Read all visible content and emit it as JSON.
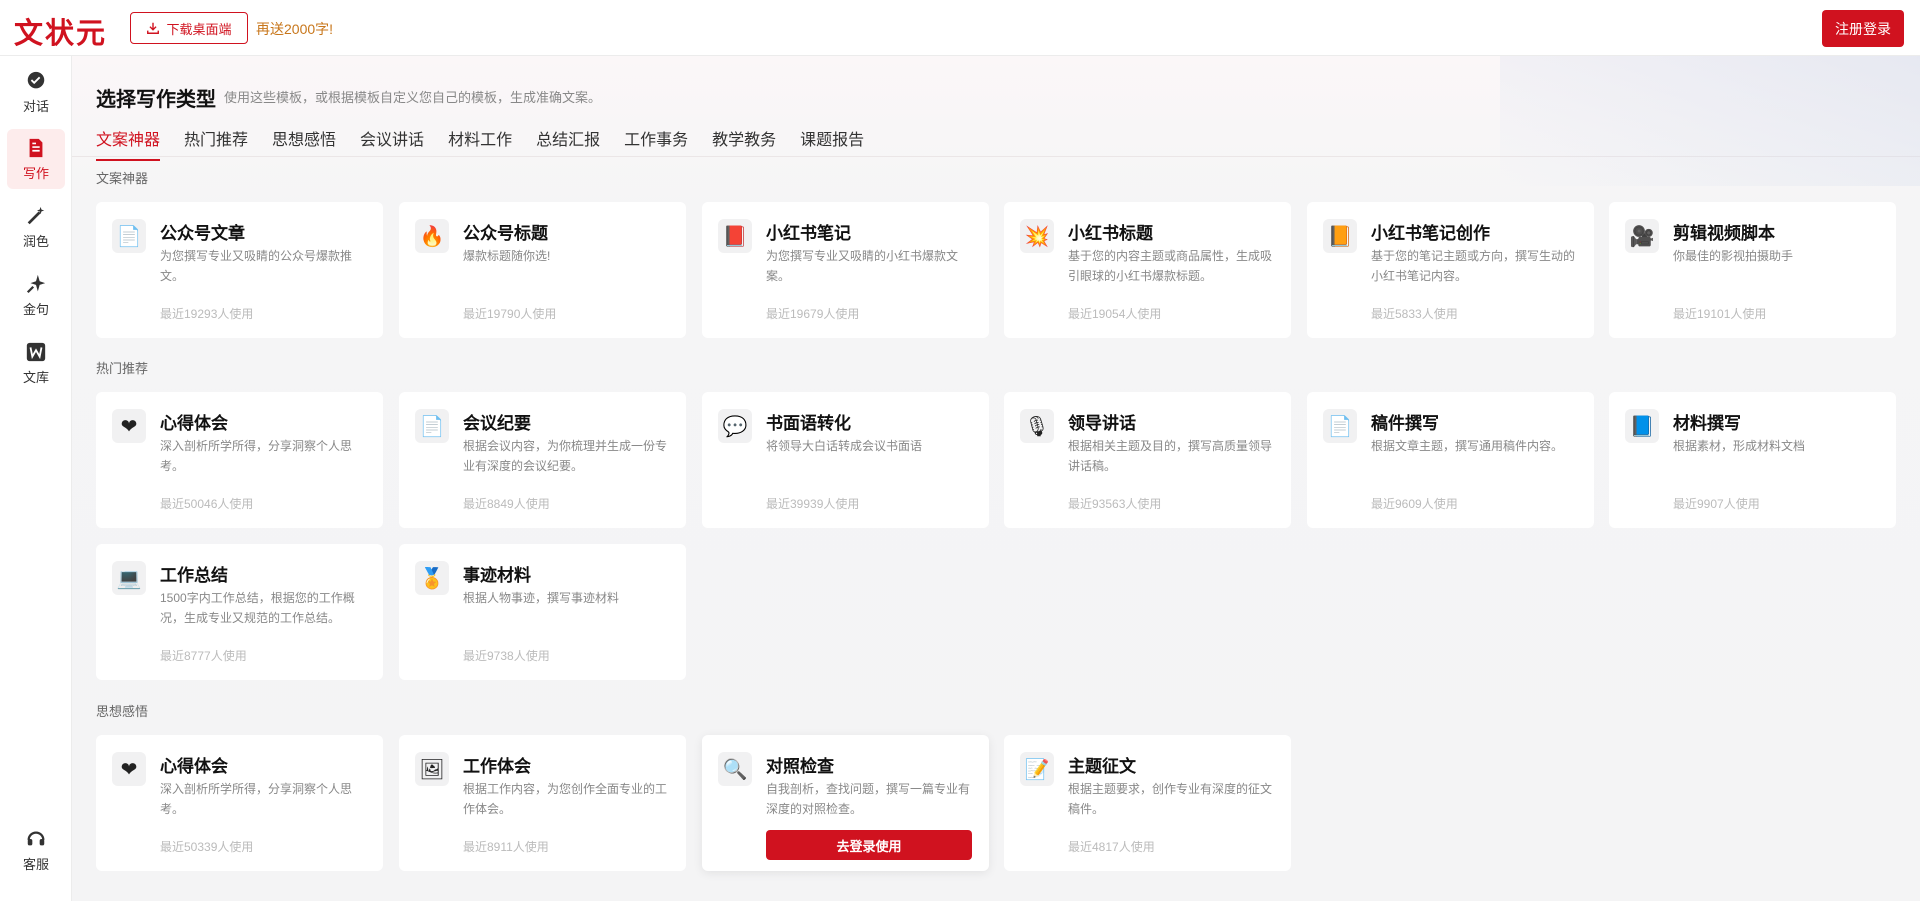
{
  "header": {
    "logo": "文状元",
    "download_label": "下载桌面端",
    "promo": "再送2000字!",
    "login_label": "注册登录"
  },
  "sidenav": [
    {
      "label": "对话",
      "icon": "chat-bubble-icon"
    },
    {
      "label": "写作",
      "icon": "document-icon",
      "active": true
    },
    {
      "label": "润色",
      "icon": "magic-wand-icon"
    },
    {
      "label": "金句",
      "icon": "sparkle-icon"
    },
    {
      "label": "文库",
      "icon": "w-library-icon"
    },
    {
      "label": "客服",
      "icon": "headset-icon"
    }
  ],
  "page": {
    "title": "选择写作类型",
    "subtitle": "使用这些模板，或根据模板自定义您自己的模板，生成准确文案。"
  },
  "tabs": [
    "文案神器",
    "热门推荐",
    "思想感悟",
    "会议讲话",
    "材料工作",
    "总结汇报",
    "工作事务",
    "教学教务",
    "课题报告"
  ],
  "active_tab": "文案神器",
  "sections": [
    {
      "label": "文案神器",
      "cards": [
        {
          "icon": "📄",
          "icon_name": "page-icon",
          "title": "公众号文章",
          "desc": "为您撰写专业又吸睛的公众号爆款推文。",
          "usage": "最近19293人使用"
        },
        {
          "icon": "🔥",
          "icon_name": "fire-icon",
          "title": "公众号标题",
          "desc": "爆款标题随你选!",
          "usage": "最近19790人使用"
        },
        {
          "icon": "📕",
          "icon_name": "red-book-icon",
          "title": "小红书笔记",
          "desc": "为您撰写专业又吸睛的小红书爆款文案。",
          "usage": "最近19679人使用"
        },
        {
          "icon": "💥",
          "icon_name": "explosion-icon",
          "title": "小红书标题",
          "desc": "基于您的内容主题或商品属性，生成吸引眼球的小红书爆款标题。",
          "usage": "最近19054人使用"
        },
        {
          "icon": "📙",
          "icon_name": "notebook-icon",
          "title": "小红书笔记创作",
          "desc": "基于您的笔记主题或方向，撰写生动的小红书笔记内容。",
          "usage": "最近5833人使用"
        },
        {
          "icon": "🎥",
          "icon_name": "video-camera-icon",
          "title": "剪辑视频脚本",
          "desc": "你最佳的影视拍摄助手",
          "usage": "最近19101人使用"
        }
      ]
    },
    {
      "label": "热门推荐",
      "cards": [
        {
          "icon": "❤",
          "icon_name": "heart-icon",
          "title": "心得体会",
          "desc": "深入剖析所学所得，分享洞察个人思考。",
          "usage": "最近50046人使用"
        },
        {
          "icon": "📄",
          "icon_name": "page-icon",
          "title": "会议纪要",
          "desc": "根据会议内容，为你梳理并生成一份专业有深度的会议纪要。",
          "usage": "最近8849人使用"
        },
        {
          "icon": "💬",
          "icon_name": "speech-bubble-icon",
          "title": "书面语转化",
          "desc": "将领导大白话转成会议书面语",
          "usage": "最近39939人使用"
        },
        {
          "icon": "🎙",
          "icon_name": "microphone-icon",
          "title": "领导讲话",
          "desc": "根据相关主题及目的，撰写高质量领导讲话稿。",
          "usage": "最近93563人使用"
        },
        {
          "icon": "📄",
          "icon_name": "page-icon",
          "title": "稿件撰写",
          "desc": "根据文章主题，撰写通用稿件内容。",
          "usage": "最近9609人使用"
        },
        {
          "icon": "📘",
          "icon_name": "blue-book-icon",
          "title": "材料撰写",
          "desc": "根据素材，形成材料文档",
          "usage": "最近9907人使用"
        },
        {
          "icon": "💻",
          "icon_name": "laptop-icon",
          "title": "工作总结",
          "desc": "1500字内工作总结，根据您的工作概况，生成专业又规范的工作总结。",
          "usage": "最近8777人使用"
        },
        {
          "icon": "🏅",
          "icon_name": "medal-icon",
          "title": "事迹材料",
          "desc": "根据人物事迹，撰写事迹材料",
          "usage": "最近9738人使用"
        }
      ]
    },
    {
      "label": "思想感悟",
      "cards": [
        {
          "icon": "❤",
          "icon_name": "heart-icon",
          "title": "心得体会",
          "desc": "深入剖析所学所得，分享洞察个人思考。",
          "usage": "最近50339人使用"
        },
        {
          "icon": "🖼",
          "icon_name": "picture-icon",
          "title": "工作体会",
          "desc": "根据工作内容，为您创作全面专业的工作体会。",
          "usage": "最近8911人使用"
        },
        {
          "icon": "🔍",
          "icon_name": "magnifier-icon",
          "title": "对照检查",
          "desc": "自我剖析，查找问题，撰写一篇专业有深度的对照检查。",
          "cta": "去登录使用",
          "hover": true
        },
        {
          "icon": "📝",
          "icon_name": "memo-icon",
          "title": "主题征文",
          "desc": "根据主题要求，创作专业有深度的征文稿件。",
          "usage": "最近4817人使用"
        }
      ]
    }
  ],
  "colors": {
    "brand": "#d0121f",
    "promo": "#c8771c"
  }
}
